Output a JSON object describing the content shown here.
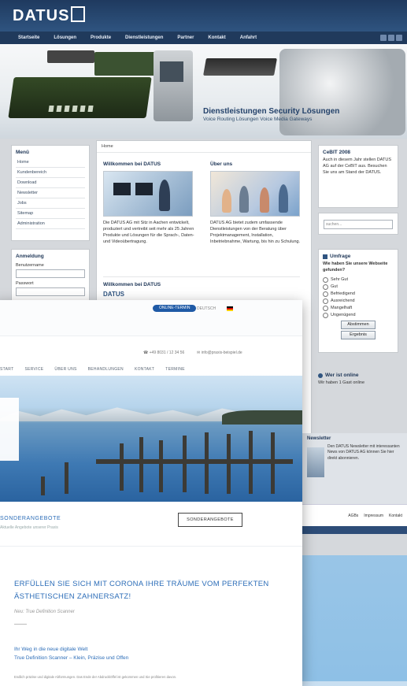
{
  "old_site": {
    "logo": "DATUS",
    "nav": [
      "Startseite",
      "Lösungen",
      "Produkte",
      "Dienstleistungen",
      "Partner",
      "Kontakt",
      "Anfahrt"
    ],
    "hero": {
      "title": "Dienstleistungen Security Lösungen",
      "subtitle": "Voice Routing Lösungen Voice Media Gateways"
    },
    "breadcrumb": "Home",
    "menu": {
      "title": "Menü",
      "items": [
        "Home",
        "Kundenbereich",
        "Download",
        "Newsletter",
        "Jobs",
        "Sitemap",
        "Administration"
      ]
    },
    "login": {
      "title": "Anmeldung",
      "username_label": "Benutzername",
      "password_label": "Passwort"
    },
    "welcome": {
      "heading": "Willkommen bei DATUS",
      "text": "Die DATUS AG mit Sitz in Aachen entwickelt, produziert und vertreibt seit mehr als 25 Jahren Produkte und Lösungen für die Sprach-, Daten- und Videoübertragung."
    },
    "about": {
      "heading": "Über uns",
      "text": "DATUS AG bietet zudem umfassende Dienstleistungen von der Beratung über Projektmanagement, Installation, Inbetriebnahme, Wartung, bis hin zu Schulung."
    },
    "welcome2_heading": "Willkommen bei DATUS",
    "welcome2_logo": "DATUS",
    "cebit": {
      "title": "CeBIT 2008",
      "text": "Auch in diesem Jahr stellen DATUS AG auf der CeBIT aus. Besuchen Sie uns am Stand der DATUS."
    },
    "search_placeholder": "suchen...",
    "poll": {
      "title": "Umfrage",
      "question": "Wie haben Sie unsere Webseite gefunden?",
      "options": [
        "Sehr Gut",
        "Gut",
        "Befriedigend",
        "Ausreichend",
        "Mangelhaft",
        "Ungenügend"
      ],
      "vote_label": "Abstimmen",
      "results_label": "Ergebnis"
    },
    "online": {
      "title": "Wer ist online",
      "text": "Wir haben 1 Gast online"
    },
    "newsletter": {
      "title": "Newsletter",
      "text": "Den DATUS Newsletter mit interessanten News von DATUS AG können Sie hier direkt abonnieren."
    },
    "footer_links": [
      "AGBs",
      "Impressum",
      "Kontakt"
    ]
  },
  "new_site": {
    "top_pill": "ONLINE-TERMIN",
    "lang": "DEUTSCH",
    "phone": "+49 8031 / 12 34 56",
    "email": "info@praxis-beispiel.de",
    "nav": [
      "Start",
      "Service",
      "Über uns",
      "Behandlungen",
      "Kontakt",
      "Termine"
    ],
    "section": {
      "title": "SONDERANGEBOTE",
      "subtitle": "Aktuelle Angebote unserer Praxis",
      "button": "SONDERANGEBOTE"
    },
    "headline": "ERFÜLLEN SIE SICH MIT CORONA IHRE TRÄUME VOM PERFEKTEN ÄSTHETISCHEN ZAHNERSATZ!",
    "tagline": "Neu: True Definition Scanner",
    "body_lines": [
      "Ihr Weg in die neue digitale Welt",
      "True Definition Scanner – Klein, Präzise und Offen"
    ],
    "fineprint": "Endlich präzise und digitale Abformungen. Das Ende der Abdrucklöffel ist gekommen und Sie profitieren davon."
  },
  "colors": {
    "old_header": "#1f3a5f",
    "new_accent": "#2c6db8",
    "background": "#a9cde9"
  }
}
